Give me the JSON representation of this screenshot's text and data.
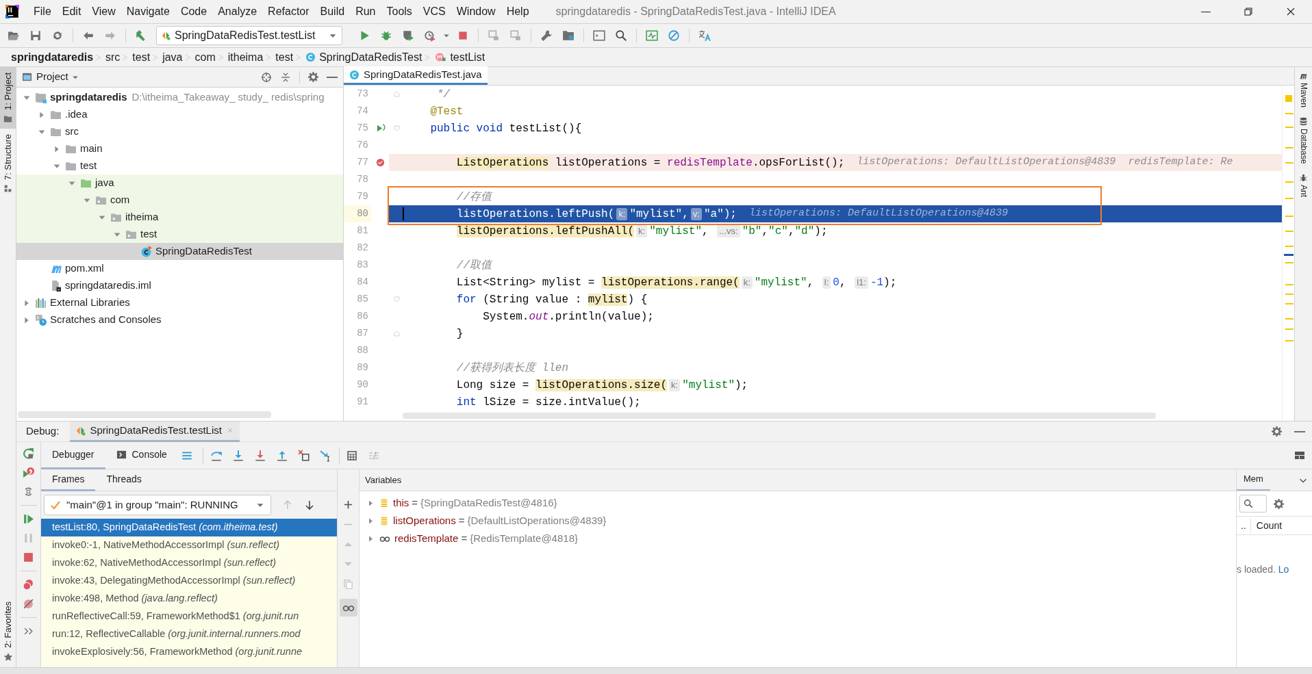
{
  "window": {
    "title": "springdataredis - SpringDataRedisTest.java - IntelliJ IDEA",
    "menus": [
      "File",
      "Edit",
      "View",
      "Navigate",
      "Code",
      "Analyze",
      "Refactor",
      "Build",
      "Run",
      "Tools",
      "VCS",
      "Window",
      "Help"
    ]
  },
  "toolbar": {
    "run_config": "SpringDataRedisTest.testList"
  },
  "breadcrumbs": [
    {
      "kind": "project",
      "label": "springdataredis"
    },
    {
      "kind": "folder",
      "label": "src"
    },
    {
      "kind": "folder",
      "label": "test"
    },
    {
      "kind": "folder",
      "label": "java"
    },
    {
      "kind": "folder",
      "label": "com"
    },
    {
      "kind": "folder",
      "label": "itheima"
    },
    {
      "kind": "folder",
      "label": "test"
    },
    {
      "kind": "class",
      "label": "SpringDataRedisTest"
    },
    {
      "kind": "method",
      "label": "testList"
    }
  ],
  "left_stripe": [
    {
      "label": "1: Project",
      "selected": true
    },
    {
      "label": "7: Structure",
      "selected": false
    }
  ],
  "left_stripe_bottom": [
    {
      "label": "2: Favorites",
      "selected": false
    }
  ],
  "right_stripe": [
    "Maven",
    "Database",
    "Ant"
  ],
  "project": {
    "title": "Project",
    "tree": [
      {
        "kind": "module",
        "label": "springdataredis",
        "path": "D:\\itheima_Takeaway_ study_ redis\\spring",
        "expanded": true,
        "selected": false,
        "highlighted": false,
        "children": [
          {
            "kind": "folder",
            "label": ".idea",
            "expanded": false,
            "selected": false,
            "highlighted": false
          },
          {
            "kind": "folder",
            "label": "src",
            "expanded": true,
            "selected": false,
            "highlighted": false,
            "children": [
              {
                "kind": "folder",
                "label": "main",
                "expanded": false,
                "selected": false,
                "highlighted": false
              },
              {
                "kind": "folder",
                "label": "test",
                "expanded": true,
                "selected": false,
                "highlighted": false,
                "children": [
                  {
                    "kind": "test_root",
                    "label": "java",
                    "expanded": true,
                    "selected": false,
                    "highlighted": true,
                    "children": [
                      {
                        "kind": "package",
                        "label": "com",
                        "expanded": true,
                        "selected": false,
                        "highlighted": true,
                        "children": [
                          {
                            "kind": "package",
                            "label": "itheima",
                            "expanded": true,
                            "selected": false,
                            "highlighted": true,
                            "children": [
                              {
                                "kind": "package",
                                "label": "test",
                                "expanded": true,
                                "selected": false,
                                "highlighted": true,
                                "children": [
                                  {
                                    "kind": "class",
                                    "label": "SpringDataRedisTest",
                                    "selected": true,
                                    "highlighted": false
                                  }
                                ]
                              }
                            ]
                          }
                        ]
                      }
                    ]
                  }
                ]
              }
            ]
          },
          {
            "kind": "maven",
            "label": "pom.xml",
            "selected": false,
            "highlighted": false
          },
          {
            "kind": "iml",
            "label": "springdataredis.iml",
            "selected": false,
            "highlighted": false
          }
        ]
      },
      {
        "kind": "libraries",
        "label": "External Libraries",
        "expanded": false,
        "selected": false,
        "highlighted": false
      },
      {
        "kind": "scratches",
        "label": "Scratches and Consoles",
        "expanded": false,
        "selected": false,
        "highlighted": false
      }
    ]
  },
  "editor": {
    "tabs": [
      {
        "label": "SpringDataRedisTest.java",
        "selected": true
      }
    ],
    "lines": [
      {
        "number": "73",
        "breakpoint": false,
        "run_marker": false,
        "fold_start": false,
        "fold_end": true,
        "current": false,
        "boxed": false,
        "segments": [
          {
            "kind": "comment",
            "text": "     */"
          }
        ]
      },
      {
        "number": "74",
        "breakpoint": false,
        "run_marker": false,
        "fold_start": false,
        "fold_end": false,
        "current": false,
        "boxed": false,
        "segments": [
          {
            "kind": "annotation",
            "text": "    @Test"
          }
        ]
      },
      {
        "number": "75",
        "breakpoint": false,
        "run_marker": true,
        "fold_start": true,
        "fold_end": false,
        "current": false,
        "boxed": false,
        "segments": [
          {
            "kind": "keyword",
            "text": "    public void"
          },
          {
            "kind": "plain",
            "text": " testList(){"
          }
        ]
      },
      {
        "number": "76",
        "breakpoint": false,
        "run_marker": false,
        "fold_start": false,
        "fold_end": false,
        "current": false,
        "boxed": false
      },
      {
        "number": "77",
        "breakpoint": true,
        "run_marker": false,
        "fold_start": false,
        "fold_end": false,
        "current": false,
        "boxed": false,
        "segments": [
          {
            "kind": "usage",
            "text": "        ListOperations"
          },
          {
            "kind": "plain",
            "text": " listOperations = "
          },
          {
            "kind": "field",
            "text": "redisTemplate"
          },
          {
            "kind": "plain",
            "text": ".opsForList();"
          },
          {
            "kind": "hint",
            "text": "listOperations: DefaultListOperations@4839  redisTemplate: Re"
          }
        ]
      },
      {
        "number": "78",
        "breakpoint": false,
        "run_marker": false,
        "fold_start": false,
        "fold_end": false,
        "current": false,
        "boxed": false
      },
      {
        "number": "79",
        "breakpoint": false,
        "run_marker": false,
        "fold_start": false,
        "fold_end": false,
        "current": false,
        "boxed": true,
        "segments": [
          {
            "kind": "comment",
            "text": "        //存值"
          }
        ]
      },
      {
        "number": "80",
        "breakpoint": false,
        "run_marker": false,
        "fold_start": false,
        "fold_end": false,
        "current": true,
        "boxed": true,
        "segments": [
          {
            "kind": "plain",
            "text": "        listOperations.leftPush("
          },
          {
            "kind": "inlay",
            "text": "k:"
          },
          {
            "kind": "string",
            "text": "\"mylist\""
          },
          {
            "kind": "plain",
            "text": ","
          },
          {
            "kind": "inlay",
            "text": "v:"
          },
          {
            "kind": "string",
            "text": "\"a\""
          },
          {
            "kind": "plain",
            "text": ");"
          },
          {
            "kind": "hint",
            "text": "listOperations: DefaultListOperations@4839"
          }
        ]
      },
      {
        "number": "81",
        "breakpoint": false,
        "run_marker": false,
        "fold_start": false,
        "fold_end": false,
        "current": false,
        "boxed": false,
        "segments": [
          {
            "kind": "usage",
            "text": "        listOperations.leftPushAll("
          },
          {
            "kind": "inlay",
            "text": "k:"
          },
          {
            "kind": "string",
            "text": "\"mylist\""
          },
          {
            "kind": "plain",
            "text": ", "
          },
          {
            "kind": "inlay",
            "text": "...vs:"
          },
          {
            "kind": "string",
            "text": "\"b\""
          },
          {
            "kind": "plain",
            "text": ","
          },
          {
            "kind": "string",
            "text": "\"c\""
          },
          {
            "kind": "plain",
            "text": ","
          },
          {
            "kind": "string",
            "text": "\"d\""
          },
          {
            "kind": "plain",
            "text": ");"
          }
        ]
      },
      {
        "number": "82",
        "breakpoint": false,
        "run_marker": false,
        "fold_start": false,
        "fold_end": false,
        "current": false,
        "boxed": false
      },
      {
        "number": "83",
        "breakpoint": false,
        "run_marker": false,
        "fold_start": false,
        "fold_end": false,
        "current": false,
        "boxed": false,
        "segments": [
          {
            "kind": "comment",
            "text": "        //取值"
          }
        ]
      },
      {
        "number": "84",
        "breakpoint": false,
        "run_marker": false,
        "fold_start": false,
        "fold_end": false,
        "current": false,
        "boxed": false,
        "segments": [
          {
            "kind": "plain",
            "text": "        List<String> mylist = "
          },
          {
            "kind": "usage",
            "text": "listOperations.range("
          },
          {
            "kind": "inlay",
            "text": "k:"
          },
          {
            "kind": "string",
            "text": "\"mylist\""
          },
          {
            "kind": "plain",
            "text": ", "
          },
          {
            "kind": "inlay",
            "text": "l:"
          },
          {
            "kind": "number",
            "text": "0"
          },
          {
            "kind": "plain",
            "text": ", "
          },
          {
            "kind": "inlay",
            "text": "l1:"
          },
          {
            "kind": "number",
            "text": "-1"
          },
          {
            "kind": "plain",
            "text": ");"
          }
        ]
      },
      {
        "number": "85",
        "breakpoint": false,
        "run_marker": false,
        "fold_start": true,
        "fold_end": false,
        "current": false,
        "boxed": false,
        "segments": [
          {
            "kind": "keyword",
            "text": "        for"
          },
          {
            "kind": "plain",
            "text": " (String value : "
          },
          {
            "kind": "usage",
            "text": "mylist"
          },
          {
            "kind": "plain",
            "text": ") {"
          }
        ]
      },
      {
        "number": "86",
        "breakpoint": false,
        "run_marker": false,
        "fold_start": false,
        "fold_end": false,
        "current": false,
        "boxed": false,
        "segments": [
          {
            "kind": "plain",
            "text": "            System."
          },
          {
            "kind": "static",
            "text": "out"
          },
          {
            "kind": "plain",
            "text": ".println(value);"
          }
        ]
      },
      {
        "number": "87",
        "breakpoint": false,
        "run_marker": false,
        "fold_start": false,
        "fold_end": true,
        "current": false,
        "boxed": false,
        "segments": [
          {
            "kind": "plain",
            "text": "        }"
          }
        ]
      },
      {
        "number": "88",
        "breakpoint": false,
        "run_marker": false,
        "fold_start": false,
        "fold_end": false,
        "current": false,
        "boxed": false
      },
      {
        "number": "89",
        "breakpoint": false,
        "run_marker": false,
        "fold_start": false,
        "fold_end": false,
        "current": false,
        "boxed": false,
        "segments": [
          {
            "kind": "comment",
            "text": "        //获得列表长度 llen"
          }
        ]
      },
      {
        "number": "90",
        "breakpoint": false,
        "run_marker": false,
        "fold_start": false,
        "fold_end": false,
        "current": false,
        "boxed": false,
        "segments": [
          {
            "kind": "plain",
            "text": "        Long size = "
          },
          {
            "kind": "usage",
            "text": "listOperations.size("
          },
          {
            "kind": "inlay",
            "text": "k:"
          },
          {
            "kind": "string",
            "text": "\"mylist\""
          },
          {
            "kind": "plain",
            "text": ");"
          }
        ]
      },
      {
        "number": "91",
        "breakpoint": false,
        "run_marker": false,
        "fold_start": false,
        "fold_end": false,
        "current": false,
        "boxed": false,
        "segments": [
          {
            "kind": "keyword",
            "text": "        int"
          },
          {
            "kind": "plain",
            "text": " lSize = size.intValue();"
          }
        ]
      }
    ]
  },
  "debug": {
    "label": "Debug:",
    "session_tab": {
      "label": "SpringDataRedisTest.testList",
      "selected": true
    },
    "tabs": [
      {
        "label": "Debugger",
        "selected": true
      },
      {
        "label": "Console",
        "selected": false
      }
    ],
    "frame_tabs": [
      {
        "label": "Frames",
        "selected": true
      },
      {
        "label": "Threads",
        "selected": false
      }
    ],
    "thread": "\"main\"@1 in group \"main\": RUNNING",
    "frames": [
      {
        "location": "testList:80, SpringDataRedisTest",
        "package": "(com.itheima.test)",
        "selected": true
      },
      {
        "location": "invoke0:-1, NativeMethodAccessorImpl",
        "package": "(sun.reflect)",
        "selected": false
      },
      {
        "location": "invoke:62, NativeMethodAccessorImpl",
        "package": "(sun.reflect)",
        "selected": false
      },
      {
        "location": "invoke:43, DelegatingMethodAccessorImpl",
        "package": "(sun.reflect)",
        "selected": false
      },
      {
        "location": "invoke:498, Method",
        "package": "(java.lang.reflect)",
        "selected": false
      },
      {
        "location": "runReflectiveCall:59, FrameworkMethod$1",
        "package": "(org.junit.run",
        "selected": false
      },
      {
        "location": "run:12, ReflectiveCallable",
        "package": "(org.junit.internal.runners.mod",
        "selected": false
      },
      {
        "location": "invokeExplosively:56, FrameworkMethod",
        "package": "(org.junit.runne",
        "selected": false
      }
    ],
    "variables_title": "Variables",
    "variables": [
      {
        "kind": "field",
        "name": "this",
        "operator": "=",
        "value": "{SpringDataRedisTest@4816}"
      },
      {
        "kind": "field",
        "name": "listOperations",
        "operator": "=",
        "value": "{DefaultListOperations@4839}"
      },
      {
        "kind": "watch",
        "name": "redisTemplate",
        "operator": "=",
        "value": "{RedisTemplate@4818}"
      }
    ],
    "memory": {
      "tab": "Mem",
      "column_1": "..",
      "column_2": "Count",
      "message": "s loaded.",
      "link": "Lo"
    }
  }
}
